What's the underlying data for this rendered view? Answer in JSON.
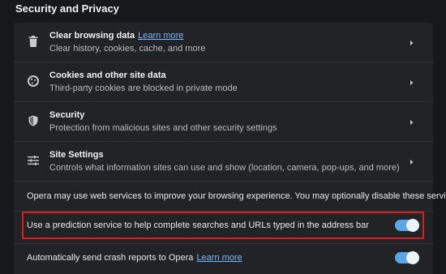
{
  "section": {
    "title": "Security and Privacy"
  },
  "rows": [
    {
      "title": "Clear browsing data",
      "link": "Learn more",
      "subtitle": "Clear history, cookies, cache, and more",
      "icon": "trash-icon"
    },
    {
      "title": "Cookies and other site data",
      "subtitle": "Third-party cookies are blocked in private mode",
      "icon": "cookie-icon"
    },
    {
      "title": "Security",
      "subtitle": "Protection from malicious sites and other security settings",
      "icon": "shield-icon"
    },
    {
      "title": "Site Settings",
      "subtitle": "Controls what information sites can use and show (location, camera, pop-ups, and more)",
      "icon": "sliders-icon"
    }
  ],
  "note": "Opera may use web services to improve your browsing experience. You may optionally disable these services.",
  "toggles": [
    {
      "label": "Use a prediction service to help complete searches and URLs typed in the address bar",
      "enabled": true
    },
    {
      "label": "Automatically send crash reports to Opera",
      "link": "Learn more",
      "enabled": true
    }
  ],
  "colors": {
    "background": "#17181c",
    "card": "#222327",
    "link": "#7ab8ff",
    "toggle_on": "#5aa7e8",
    "highlight": "#e01919"
  }
}
